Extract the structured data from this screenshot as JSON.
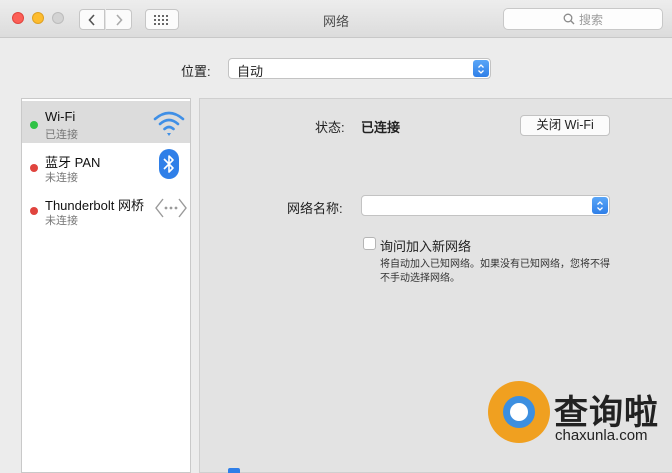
{
  "window": {
    "title": "网络",
    "search_placeholder": "搜索"
  },
  "location": {
    "label": "位置:",
    "value": "自动"
  },
  "services": [
    {
      "name": "Wi-Fi",
      "status": "已连接",
      "status_color": "#2fc245",
      "icon": "wifi-icon",
      "selected": true
    },
    {
      "name": "蓝牙 PAN",
      "status": "未连接",
      "status_color": "#e0443e",
      "icon": "bluetooth-icon",
      "selected": false
    },
    {
      "name": "Thunderbolt 网桥",
      "status": "未连接",
      "status_color": "#e0443e",
      "icon": "thunderbolt-bridge-icon",
      "selected": false
    }
  ],
  "detail": {
    "status_label": "状态:",
    "status_value": "已连接",
    "wifi_off_button": "关闭 Wi-Fi",
    "network_name_label": "网络名称:",
    "network_name_value": "",
    "ask_join_label": "询问加入新网络",
    "ask_join_checked": false,
    "ask_join_desc": "将自动加入已知网络。如果没有已知网络，您将不得不手动选择网络。"
  },
  "watermark": {
    "text": "查询啦",
    "url": "chaxunla.com"
  },
  "colors": {
    "accent": "#2f7fe8",
    "sidebar_selected": "#dcdcdc"
  }
}
